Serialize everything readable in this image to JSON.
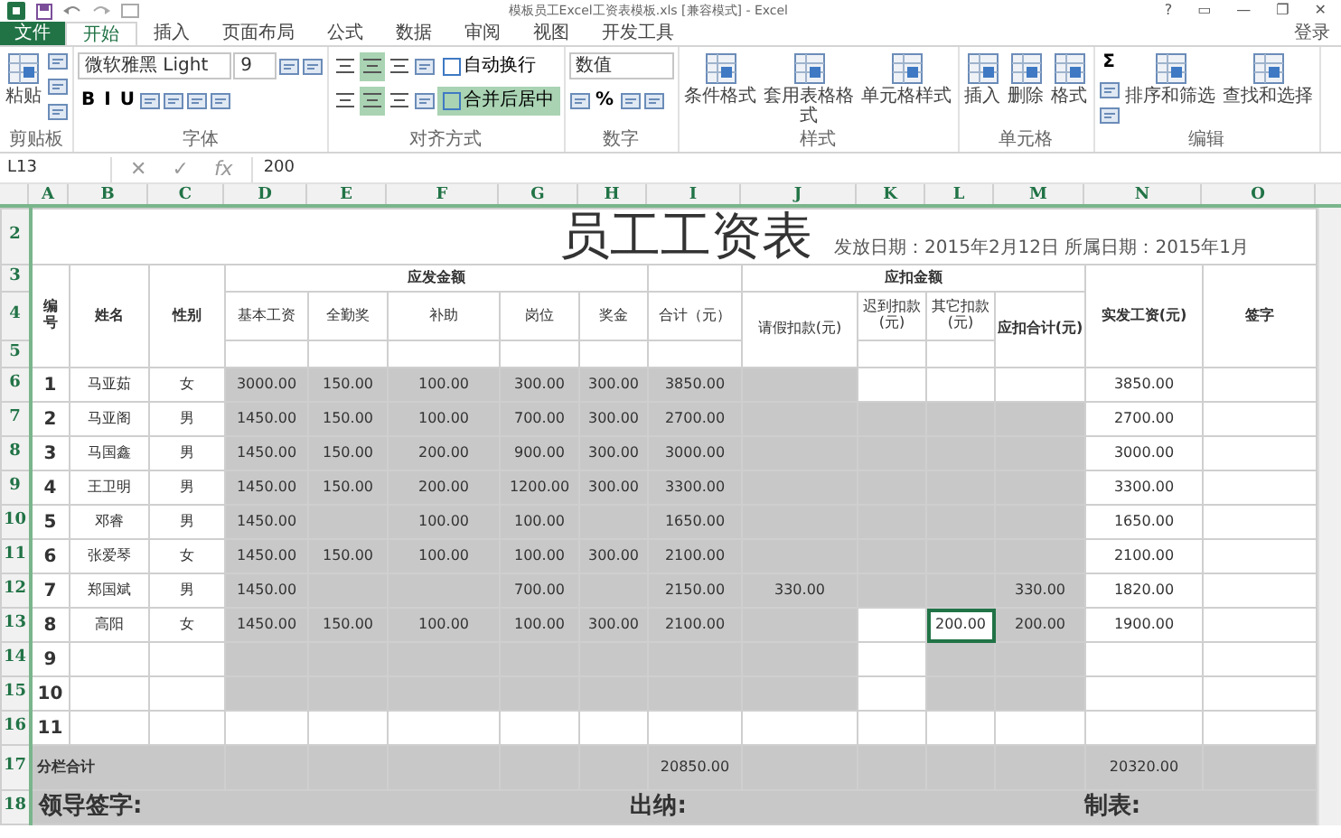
{
  "title_bar": {
    "title": "模板员工Excel工资表模板.xls [兼容模式] - Excel",
    "buttons": [
      "?",
      "▭",
      "—",
      "❐",
      "✕"
    ]
  },
  "tabs": [
    {
      "label": "文件",
      "kind": "file",
      "selected": false
    },
    {
      "label": "开始",
      "kind": "tab",
      "selected": true
    },
    {
      "label": "插入",
      "kind": "tab",
      "selected": false
    },
    {
      "label": "页面布局",
      "kind": "tab",
      "selected": false
    },
    {
      "label": "公式",
      "kind": "tab",
      "selected": false
    },
    {
      "label": "数据",
      "kind": "tab",
      "selected": false
    },
    {
      "label": "审阅",
      "kind": "tab",
      "selected": false
    },
    {
      "label": "视图",
      "kind": "tab",
      "selected": false
    },
    {
      "label": "开发工具",
      "kind": "tab",
      "selected": false
    }
  ],
  "sign_in": "登录",
  "ribbon": [
    {
      "label": "剪贴板",
      "items": [
        {
          "kind": "big",
          "label": "粘贴"
        },
        {
          "kind": "column",
          "items": [
            {
              "kind": "icon"
            },
            {
              "kind": "icon"
            },
            {
              "kind": "icon"
            }
          ]
        }
      ]
    },
    {
      "label": "字体",
      "items": [
        {
          "kind": "column",
          "items": [
            {
              "kind": "line",
              "items": [
                {
                  "kind": "select",
                  "value": "微软雅黑 Light"
                },
                {
                  "kind": "select",
                  "value": "9"
                },
                {
                  "kind": "icon"
                },
                {
                  "kind": "icon"
                }
              ]
            },
            {
              "kind": "line",
              "items": [
                {
                  "kind": "text",
                  "text": "B"
                },
                {
                  "kind": "text",
                  "text": "I"
                },
                {
                  "kind": "text",
                  "text": "U"
                },
                {
                  "kind": "icon"
                },
                {
                  "kind": "icon"
                },
                {
                  "kind": "icon"
                },
                {
                  "kind": "icon"
                }
              ]
            }
          ]
        }
      ]
    },
    {
      "label": "对齐方式",
      "items": [
        {
          "kind": "column",
          "items": [
            {
              "kind": "line",
              "items": [
                {
                  "kind": "toggle",
                  "selected": false
                },
                {
                  "kind": "toggle",
                  "selected": true
                },
                {
                  "kind": "toggle",
                  "selected": false
                },
                {
                  "kind": "icon"
                },
                {
                  "kind": "wide",
                  "label": "自动换行",
                  "selected": false
                }
              ]
            },
            {
              "kind": "line",
              "items": [
                {
                  "kind": "toggle",
                  "selected": false
                },
                {
                  "kind": "toggle",
                  "selected": true
                },
                {
                  "kind": "toggle",
                  "selected": false
                },
                {
                  "kind": "icon"
                },
                {
                  "kind": "wide",
                  "label": "合并后居中",
                  "selected": true
                }
              ]
            }
          ]
        }
      ]
    },
    {
      "label": "数字",
      "items": [
        {
          "kind": "column",
          "items": [
            {
              "kind": "line",
              "items": [
                {
                  "kind": "select",
                  "value": "数值"
                }
              ]
            },
            {
              "kind": "line",
              "items": [
                {
                  "kind": "icon"
                },
                {
                  "kind": "text",
                  "text": "%"
                },
                {
                  "kind": "icon"
                },
                {
                  "kind": "icon"
                }
              ]
            }
          ]
        }
      ]
    },
    {
      "label": "样式",
      "items": [
        {
          "kind": "big",
          "label": "条件格式"
        },
        {
          "kind": "big",
          "label": "套用表格格式"
        },
        {
          "kind": "big",
          "label": "单元格样式"
        }
      ]
    },
    {
      "label": "单元格",
      "items": [
        {
          "kind": "big",
          "label": "插入"
        },
        {
          "kind": "big",
          "label": "删除"
        },
        {
          "kind": "big",
          "label": "格式"
        }
      ]
    },
    {
      "label": "编辑",
      "items": [
        {
          "kind": "column",
          "items": [
            {
              "kind": "text",
              "text": "Σ"
            },
            {
              "kind": "icon"
            },
            {
              "kind": "icon"
            }
          ]
        },
        {
          "kind": "big",
          "label": "排序和筛选"
        },
        {
          "kind": "big",
          "label": "查找和选择"
        }
      ]
    }
  ],
  "formula_bar": {
    "cell": "L13",
    "cancel": "✕",
    "enter": "✓",
    "function": "fx",
    "value": "200"
  },
  "column_headers": [
    "A",
    "B",
    "C",
    "D",
    "E",
    "F",
    "G",
    "H",
    "I",
    "J",
    "K",
    "L",
    "M",
    "N",
    "O"
  ],
  "sheet": {
    "title_row": "2",
    "title": "员工工资表",
    "dates": "发放日期：2015年2月12日 所属日期：2015年1月",
    "header_rows": [
      "3",
      "4",
      "5"
    ],
    "headers": {
      "number": "编号",
      "name": "姓名",
      "gender": "性别",
      "payable": "应发金额",
      "payable_items": [
        "基本工资",
        "全勤奖",
        "补助",
        "岗位",
        "奖金"
      ],
      "payable_total": "合计（元）",
      "deductions": "应扣金额",
      "deduction_items": [
        "请假扣款(元)",
        "迟到扣款(元)",
        "其它扣款(元)",
        "应扣合计(元)"
      ],
      "net": "实发工资(元)",
      "signature": "签字"
    },
    "rows": [
      {
        "row": "6",
        "number": "1",
        "name": "马亚茹",
        "gender": "女",
        "cells": [
          {
            "text": "3000.00",
            "shaded": true
          },
          {
            "text": "150.00",
            "shaded": true
          },
          {
            "text": "100.00",
            "shaded": true
          },
          {
            "text": "300.00",
            "shaded": true
          },
          {
            "text": "300.00",
            "shaded": true
          },
          {
            "text": "3850.00",
            "shaded": true
          },
          {
            "shaded": true
          },
          {
            "shaded": false
          },
          {
            "shaded": false,
            "selected": false
          },
          {
            "shaded": false
          },
          {
            "text": "3850.00",
            "shaded": false
          }
        ]
      },
      {
        "row": "7",
        "number": "2",
        "name": "马亚阁",
        "gender": "男",
        "cells": [
          {
            "text": "1450.00",
            "shaded": true
          },
          {
            "text": "150.00",
            "shaded": true
          },
          {
            "text": "100.00",
            "shaded": true
          },
          {
            "text": "700.00",
            "shaded": true
          },
          {
            "text": "300.00",
            "shaded": true
          },
          {
            "text": "2700.00",
            "shaded": true
          },
          {
            "shaded": true
          },
          {
            "shaded": true
          },
          {
            "shaded": true,
            "selected": false
          },
          {
            "shaded": true
          },
          {
            "text": "2700.00",
            "shaded": false
          }
        ]
      },
      {
        "row": "8",
        "number": "3",
        "name": "马国鑫",
        "gender": "男",
        "cells": [
          {
            "text": "1450.00",
            "shaded": true
          },
          {
            "text": "150.00",
            "shaded": true
          },
          {
            "text": "200.00",
            "shaded": true
          },
          {
            "text": "900.00",
            "shaded": true
          },
          {
            "text": "300.00",
            "shaded": true
          },
          {
            "text": "3000.00",
            "shaded": true
          },
          {
            "shaded": true
          },
          {
            "shaded": true
          },
          {
            "shaded": true,
            "selected": false
          },
          {
            "shaded": true
          },
          {
            "text": "3000.00",
            "shaded": false
          }
        ]
      },
      {
        "row": "9",
        "number": "4",
        "name": "王卫明",
        "gender": "男",
        "cells": [
          {
            "text": "1450.00",
            "shaded": true
          },
          {
            "text": "150.00",
            "shaded": true
          },
          {
            "text": "200.00",
            "shaded": true
          },
          {
            "text": "1200.00",
            "shaded": true
          },
          {
            "text": "300.00",
            "shaded": true
          },
          {
            "text": "3300.00",
            "shaded": true
          },
          {
            "shaded": true
          },
          {
            "shaded": true
          },
          {
            "shaded": true,
            "selected": false
          },
          {
            "shaded": true
          },
          {
            "text": "3300.00",
            "shaded": false
          }
        ]
      },
      {
        "row": "10",
        "number": "5",
        "name": "邓睿",
        "gender": "男",
        "cells": [
          {
            "text": "1450.00",
            "shaded": true
          },
          {
            "shaded": true
          },
          {
            "text": "100.00",
            "shaded": true
          },
          {
            "text": "100.00",
            "shaded": true
          },
          {
            "shaded": true
          },
          {
            "text": "1650.00",
            "shaded": true
          },
          {
            "shaded": true
          },
          {
            "shaded": true
          },
          {
            "shaded": true,
            "selected": false
          },
          {
            "shaded": true
          },
          {
            "text": "1650.00",
            "shaded": false
          }
        ]
      },
      {
        "row": "11",
        "number": "6",
        "name": "张爱琴",
        "gender": "女",
        "cells": [
          {
            "text": "1450.00",
            "shaded": true
          },
          {
            "text": "150.00",
            "shaded": true
          },
          {
            "text": "100.00",
            "shaded": true
          },
          {
            "text": "100.00",
            "shaded": true
          },
          {
            "text": "300.00",
            "shaded": true
          },
          {
            "text": "2100.00",
            "shaded": true
          },
          {
            "shaded": true
          },
          {
            "shaded": true
          },
          {
            "shaded": true,
            "selected": false
          },
          {
            "shaded": true
          },
          {
            "text": "2100.00",
            "shaded": false
          }
        ]
      },
      {
        "row": "12",
        "number": "7",
        "name": "郑国斌",
        "gender": "男",
        "cells": [
          {
            "text": "1450.00",
            "shaded": true
          },
          {
            "shaded": true
          },
          {
            "shaded": true
          },
          {
            "text": "700.00",
            "shaded": true
          },
          {
            "shaded": true
          },
          {
            "text": "2150.00",
            "shaded": true
          },
          {
            "text": "330.00",
            "shaded": true
          },
          {
            "shaded": true
          },
          {
            "shaded": true,
            "selected": false
          },
          {
            "text": "330.00",
            "shaded": true
          },
          {
            "text": "1820.00",
            "shaded": false
          }
        ]
      },
      {
        "row": "13",
        "number": "8",
        "name": "高阳",
        "gender": "女",
        "cells": [
          {
            "text": "1450.00",
            "shaded": true
          },
          {
            "text": "150.00",
            "shaded": true
          },
          {
            "text": "100.00",
            "shaded": true
          },
          {
            "text": "100.00",
            "shaded": true
          },
          {
            "text": "300.00",
            "shaded": true
          },
          {
            "text": "2100.00",
            "shaded": true
          },
          {
            "shaded": true
          },
          {
            "shaded": false
          },
          {
            "text": "200.00",
            "shaded": false,
            "selected": true
          },
          {
            "text": "200.00",
            "shaded": true
          },
          {
            "text": "1900.00",
            "shaded": false
          }
        ]
      },
      {
        "row": "14",
        "number": "9",
        "cells": [
          {
            "shaded": true
          },
          {
            "shaded": true
          },
          {
            "shaded": true
          },
          {
            "shaded": true
          },
          {
            "shaded": true
          },
          {
            "shaded": true
          },
          {
            "shaded": true
          },
          {
            "shaded": false
          },
          {
            "shaded": true,
            "selected": false
          },
          {
            "shaded": true
          },
          {
            "shaded": false
          }
        ]
      },
      {
        "row": "15",
        "number": "10",
        "cells": [
          {
            "shaded": true
          },
          {
            "shaded": true
          },
          {
            "shaded": true
          },
          {
            "shaded": true
          },
          {
            "shaded": true
          },
          {
            "shaded": true
          },
          {
            "shaded": true
          },
          {
            "shaded": false
          },
          {
            "shaded": true,
            "selected": false
          },
          {
            "shaded": true
          },
          {
            "shaded": false
          }
        ]
      },
      {
        "row": "16",
        "number": "11",
        "cells": [
          {
            "shaded": false
          },
          {
            "shaded": false
          },
          {
            "shaded": false
          },
          {
            "shaded": false
          },
          {
            "shaded": false
          },
          {
            "shaded": false
          },
          {
            "shaded": false
          },
          {
            "shaded": false
          },
          {
            "shaded": false,
            "selected": false
          },
          {
            "shaded": false
          },
          {
            "shaded": false
          }
        ]
      }
    ],
    "total": {
      "row": "17",
      "label": "分栏合计",
      "cells": [
        {
          "shaded": true
        },
        {
          "shaded": true
        },
        {
          "shaded": true
        },
        {
          "shaded": true
        },
        {
          "shaded": true
        },
        {
          "text": "20850.00",
          "shaded": true
        },
        {
          "shaded": true
        },
        {
          "shaded": true
        },
        {
          "shaded": true,
          "selected": false
        },
        {
          "shaded": true
        },
        {
          "text": "20320.00",
          "shaded": true
        }
      ]
    },
    "footer": {
      "row": "18",
      "signatures": [
        "领导签字:",
        "出纳:",
        "制表:"
      ]
    }
  }
}
